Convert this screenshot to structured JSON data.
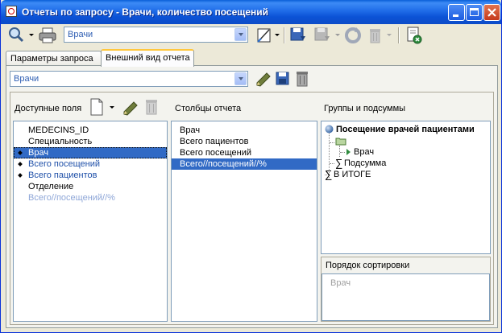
{
  "window": {
    "title": "Отчеты по запросу - Врачи, количество посещений",
    "buttons": [
      "minimize-icon",
      "maximize-icon",
      "close-icon"
    ]
  },
  "toolbar": {
    "report_combo": "Врачи",
    "icons": [
      "search-icon",
      "print-icon",
      "page-setup-icon",
      "save-icon",
      "save-disabled-icon",
      "refresh-icon",
      "delete-disabled-icon",
      "exit-icon"
    ]
  },
  "tabs": [
    {
      "label": "Параметры запроса",
      "active": false
    },
    {
      "label": "Внешний вид отчета",
      "active": true
    }
  ],
  "view": {
    "combo": "Врачи",
    "icons": [
      "edit-icon",
      "save-icon",
      "delete-icon"
    ]
  },
  "available_fields": {
    "label": "Доступные поля",
    "items": [
      {
        "text": "MEDECINS_ID",
        "bullet": false,
        "style": "normal"
      },
      {
        "text": "Специальность",
        "bullet": false,
        "style": "normal"
      },
      {
        "text": "Врач",
        "bullet": true,
        "style": "selected"
      },
      {
        "text": "Всего посещений",
        "bullet": true,
        "style": "blue"
      },
      {
        "text": "Всего пациентов",
        "bullet": true,
        "style": "blue"
      },
      {
        "text": "Отделение",
        "bullet": false,
        "style": "normal"
      },
      {
        "text": "Всего//посещений//%",
        "bullet": false,
        "style": "faded"
      }
    ]
  },
  "report_columns": {
    "label": "Столбцы отчета",
    "items": [
      {
        "text": "Врач",
        "style": "normal"
      },
      {
        "text": "Всего пациентов",
        "style": "normal"
      },
      {
        "text": "Всего посещений",
        "style": "normal"
      },
      {
        "text": "Всего//посещений//%",
        "style": "selected"
      }
    ]
  },
  "groups": {
    "label": "Группы и подсуммы",
    "root": "Посещение врачей пациентами",
    "child_field": "Врач",
    "subtotal": "Подсумма",
    "total": "В ИТОГЕ"
  },
  "sort_order": {
    "label": "Порядок сортировки",
    "items": [
      "Врач"
    ]
  },
  "colors": {
    "selection": "#316ac5",
    "title_bar": "#0b52d6",
    "link_blue": "#1e4fa8"
  }
}
